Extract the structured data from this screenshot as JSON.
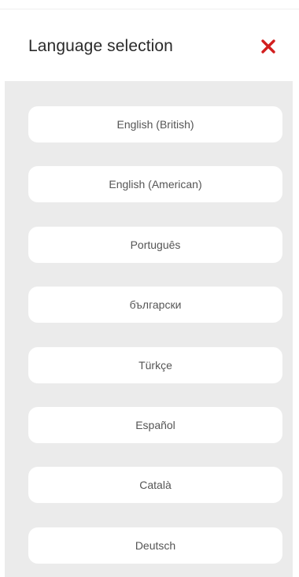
{
  "header": {
    "title": "Language selection",
    "close_icon": "close-icon",
    "close_color": "#d21e1e"
  },
  "languages": [
    "English (British)",
    "English (American)",
    "Português",
    "български",
    "Türkçe",
    "Español",
    "Català",
    "Deutsch"
  ]
}
